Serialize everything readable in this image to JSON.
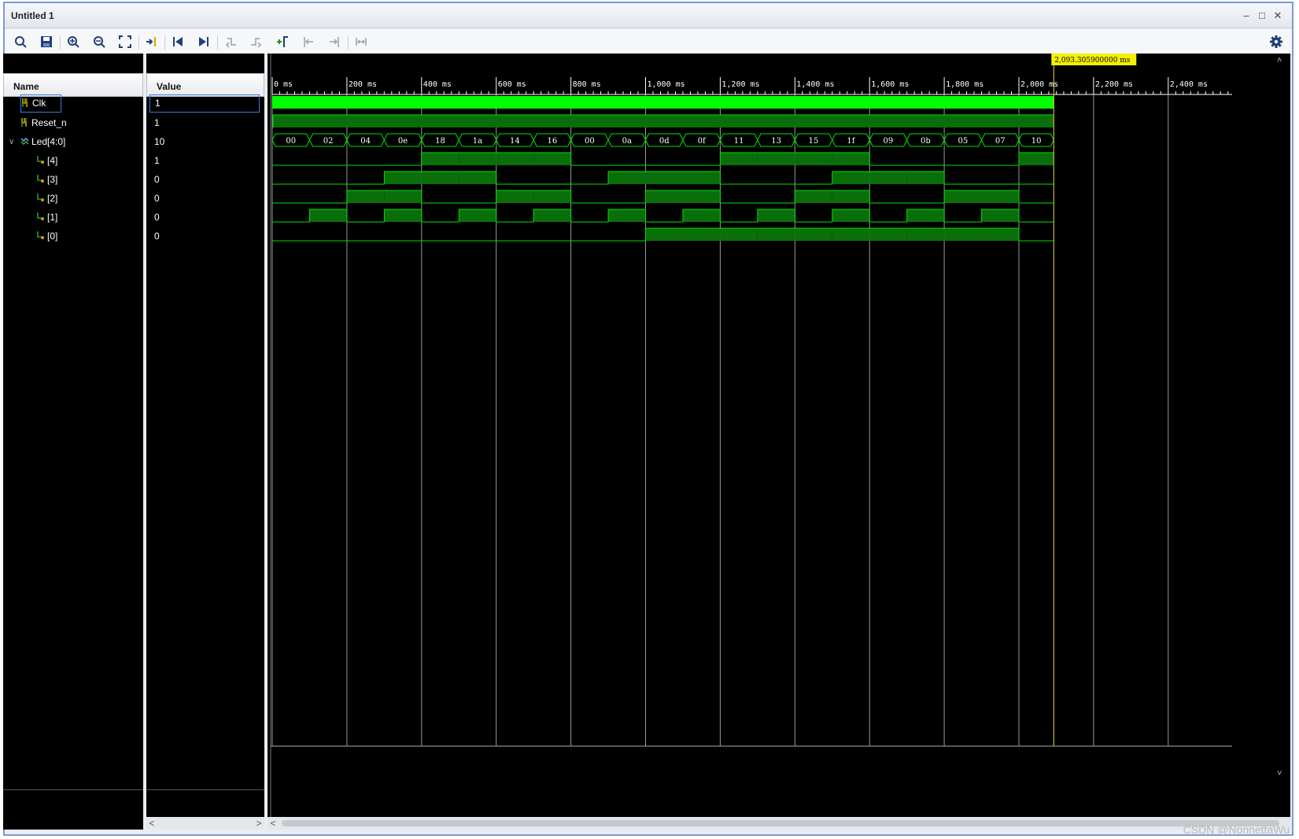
{
  "window": {
    "title": "Untitled 1"
  },
  "toolbar": {
    "icons": [
      "search-icon",
      "save-icon",
      "zoom-in-icon",
      "zoom-out-icon",
      "zoom-fit-icon",
      "go-to-cursor-icon",
      "go-to-time-zero-icon",
      "go-to-last-time-icon",
      "previous-transition-icon",
      "next-transition-icon",
      "add-marker-icon",
      "previous-marker-icon",
      "next-marker-icon",
      "swap-cursors-icon"
    ],
    "settings_icon": "gear-icon"
  },
  "columns": {
    "name": "Name",
    "value": "Value"
  },
  "signals": [
    {
      "name": "Clk",
      "value": "1",
      "kind": "bit"
    },
    {
      "name": "Reset_n",
      "value": "1",
      "kind": "bit"
    },
    {
      "name": "Led[4:0]",
      "value": "10",
      "kind": "bus"
    },
    {
      "name": "[4]",
      "value": "1",
      "kind": "child"
    },
    {
      "name": "[3]",
      "value": "0",
      "kind": "child"
    },
    {
      "name": "[2]",
      "value": "0",
      "kind": "child"
    },
    {
      "name": "[1]",
      "value": "0",
      "kind": "child"
    },
    {
      "name": "[0]",
      "value": "0",
      "kind": "child"
    }
  ],
  "timeline": {
    "ticks": [
      "0 ms",
      "200 ms",
      "400 ms",
      "600 ms",
      "800 ms",
      "1,000 ms",
      "1,200 ms",
      "1,400 ms",
      "1,600 ms",
      "1,800 ms",
      "2,000 ms",
      "2,200 ms",
      "2,400 ms"
    ],
    "cursor_label": "2,093.305900000 ms",
    "cursor_ms": 2093.3059
  },
  "bus_values": [
    "00",
    "02",
    "04",
    "0e",
    "18",
    "1a",
    "14",
    "16",
    "00",
    "0a",
    "0d",
    "0f",
    "11",
    "13",
    "15",
    "1f",
    "09",
    "0b",
    "05",
    "07",
    "10"
  ],
  "colors": {
    "wave": "#00e000",
    "wave_fill": "#0a6e0a",
    "clock_fill": "#00ff00",
    "cursor": "#e8e030",
    "grid": "#9a9a9a"
  },
  "watermark": "CSDN @NonnettaWu"
}
